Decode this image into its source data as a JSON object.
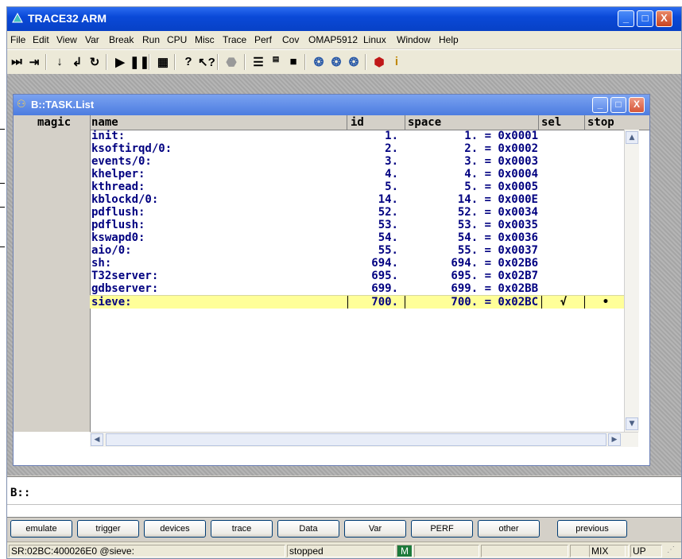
{
  "app": {
    "title": "TRACE32 ARM",
    "window_buttons": [
      "_",
      "□",
      "X"
    ]
  },
  "menu": [
    "File",
    "Edit",
    "View",
    "Var",
    "Break",
    "Run",
    "CPU",
    "Misc",
    "Trace",
    "Perf",
    "Cov",
    "OMAP5912",
    "Linux",
    "Window",
    "Help"
  ],
  "toolbar_icons": [
    "step-into-icon",
    "step-over-icon",
    "down-arrow-icon",
    "return-icon",
    "up-icon",
    "go-icon",
    "break-icon",
    "chip-icon",
    "help-icon",
    "context-help-icon",
    "stop-icon",
    "list-icon",
    "memory-icon",
    "register-icon",
    "var-icon",
    "frame-icon",
    "watch-icon",
    "dll-icon",
    "info-icon"
  ],
  "task_window": {
    "title": "B::TASK.List",
    "columns": [
      "magic",
      "name",
      "id",
      "space",
      "sel",
      "stop"
    ],
    "rows": [
      {
        "name": "init:",
        "id": "1.",
        "space": "1. = 0x0001",
        "sel": "",
        "stop": ""
      },
      {
        "name": "ksoftirqd/0:",
        "id": "2.",
        "space": "2. = 0x0002",
        "sel": "",
        "stop": ""
      },
      {
        "name": "events/0:",
        "id": "3.",
        "space": "3. = 0x0003",
        "sel": "",
        "stop": ""
      },
      {
        "name": "khelper:",
        "id": "4.",
        "space": "4. = 0x0004",
        "sel": "",
        "stop": ""
      },
      {
        "name": "kthread:",
        "id": "5.",
        "space": "5. = 0x0005",
        "sel": "",
        "stop": ""
      },
      {
        "name": "kblockd/0:",
        "id": "14.",
        "space": "14. = 0x000E",
        "sel": "",
        "stop": ""
      },
      {
        "name": "pdflush:",
        "id": "52.",
        "space": "52. = 0x0034",
        "sel": "",
        "stop": ""
      },
      {
        "name": "pdflush:",
        "id": "53.",
        "space": "53. = 0x0035",
        "sel": "",
        "stop": ""
      },
      {
        "name": "kswapd0:",
        "id": "54.",
        "space": "54. = 0x0036",
        "sel": "",
        "stop": ""
      },
      {
        "name": "aio/0:",
        "id": "55.",
        "space": "55. = 0x0037",
        "sel": "",
        "stop": ""
      },
      {
        "name": "sh:",
        "id": "694.",
        "space": "694. = 0x02B6",
        "sel": "",
        "stop": ""
      },
      {
        "name": "T32server:",
        "id": "695.",
        "space": "695. = 0x02B7",
        "sel": "",
        "stop": ""
      },
      {
        "name": "gdbserver:",
        "id": "699.",
        "space": "699. = 0x02BB",
        "sel": "",
        "stop": ""
      },
      {
        "name": "sieve:",
        "id": "700.",
        "space": "700. = 0x02BC",
        "sel": "√",
        "stop": "•"
      }
    ],
    "selected_row": 13
  },
  "command": {
    "prompt": "B::",
    "value": ""
  },
  "softkeys": [
    "emulate",
    "trigger",
    "devices",
    "trace",
    "Data",
    "Var",
    "PERF",
    "other",
    "previous"
  ],
  "status": {
    "address": "SR:02BC:400026E0 @sieve:",
    "state": "stopped",
    "mode_indicator": "M",
    "mix": "MIX",
    "up": "UP"
  },
  "colors": {
    "title_blue": "#0a49d8",
    "text_navy": "#000080",
    "selected_row": "#ffff99"
  }
}
